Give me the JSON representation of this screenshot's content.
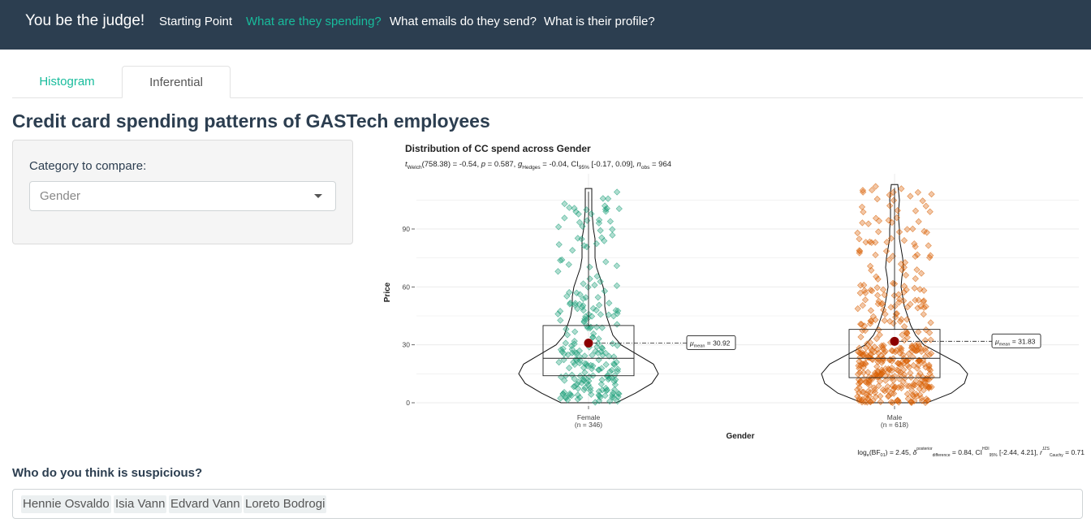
{
  "navbar": {
    "brand": "You be the judge!",
    "items": [
      {
        "label": "Starting Point",
        "active": false
      },
      {
        "label": "What are they spending?",
        "active": true
      },
      {
        "label": "What emails do they send?",
        "active": false
      },
      {
        "label": "What is their profile?",
        "active": false
      }
    ]
  },
  "tabs": [
    {
      "label": "Histogram",
      "active": false
    },
    {
      "label": "Inferential",
      "active": true
    }
  ],
  "page_title": "Credit card spending patterns of GASTech employees",
  "sidebar": {
    "label": "Category to compare:",
    "select_value": "Gender"
  },
  "suspects": {
    "label": "Who do you think is suspicious?",
    "tags": [
      "Hennie Osvaldo",
      "Isia Vann",
      "Edvard Vann",
      "Loreto Bodrogi"
    ]
  },
  "colors": {
    "navbar_bg": "#2c3e50",
    "accent": "#18bc9c",
    "female": "#1b9e77",
    "male": "#d95f02",
    "mean_point": "#8b0000"
  },
  "chart_data": {
    "type": "violin-box-scatter",
    "title": "Distribution of CC spend across Gender",
    "subtitle": {
      "t_label": "t",
      "t_sub": "Welch",
      "t_stat": "(758.38) = -0.54, ",
      "p_label": "p",
      "p_value": " = 0.587, ",
      "g_label": "g",
      "g_sub": "Hedges",
      "g_value": " = -0.04, CI",
      "ci_sub": "95%",
      "ci_value": " [-0.17, 0.09], ",
      "n_label": "n",
      "n_sub": "obs",
      "n_value": " = 964"
    },
    "xlabel": "Gender",
    "ylabel": "Price",
    "ylim": [
      0,
      110
    ],
    "yticks": [
      0,
      30,
      60,
      90
    ],
    "groups": [
      {
        "name": "Female",
        "n_label": "(n = 346)",
        "mean": 30.92,
        "mean_label": "= 30.92",
        "median": 23,
        "q1": 14,
        "q3": 40,
        "max": 111,
        "min": 0,
        "color": "#1b9e77"
      },
      {
        "name": "Male",
        "n_label": "(n = 618)",
        "mean": 31.83,
        "mean_label": "= 31.83",
        "median": 23,
        "q1": 13,
        "q3": 38,
        "max": 113,
        "min": 0,
        "color": "#d95f02"
      }
    ],
    "mean_symbol": "μ",
    "mean_sub": "mean",
    "caption": "logₑ(BF₀₁) = 2.45, δ posterior difference = 0.84, CI HDI 95% [-2.44, 4.21], r JZS Cauchy = 0.71",
    "caption_parts": {
      "a": "log",
      "a_sub": "e",
      "b": "(BF",
      "b_sub": "01",
      "c": ") = 2.45, ",
      "d": "δ",
      "d_sup": "posterior",
      "d_sub": "difference",
      "e": " = 0.84, CI",
      "e_sup": "HDI",
      "e_sub": "95%",
      "f": " [-2.44, 4.21], ",
      "g": "r",
      "g_sup": "JZS",
      "g_sub": "Cauchy",
      "h": " = 0.71"
    },
    "grid": true
  }
}
